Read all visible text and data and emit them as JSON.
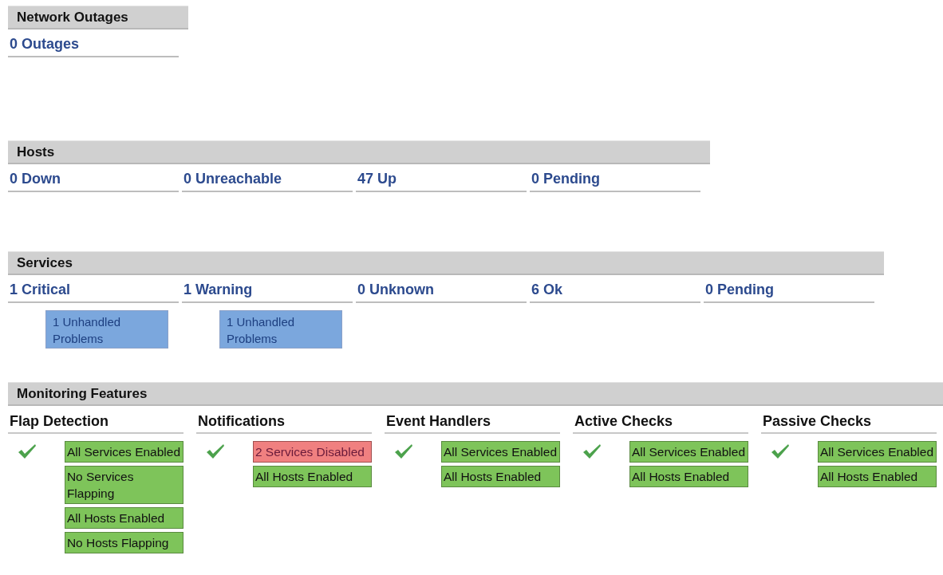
{
  "network_outages": {
    "title": "Network Outages",
    "items": [
      {
        "label": "0 Outages"
      }
    ]
  },
  "hosts": {
    "title": "Hosts",
    "items": [
      {
        "label": "0 Down"
      },
      {
        "label": "0 Unreachable"
      },
      {
        "label": "47  Up"
      },
      {
        "label": "0 Pending"
      }
    ]
  },
  "services": {
    "title": "Services",
    "items": [
      {
        "label": "1 Critical",
        "problems": "1 Unhandled Problems"
      },
      {
        "label": "1 Warning",
        "problems": "1 Unhandled Problems"
      },
      {
        "label": "0 Unknown"
      },
      {
        "label": "6 Ok"
      },
      {
        "label": "0 Pending"
      }
    ]
  },
  "monitoring_features": {
    "title": "Monitoring Features",
    "features": [
      {
        "title": "Flap Detection",
        "enabled": true,
        "badges": [
          {
            "text": "All Services Enabled",
            "kind": "ok"
          },
          {
            "text": "No Services Flapping",
            "kind": "ok"
          },
          {
            "text": "All Hosts Enabled",
            "kind": "ok"
          },
          {
            "text": "No Hosts Flapping",
            "kind": "ok"
          }
        ]
      },
      {
        "title": "Notifications",
        "enabled": true,
        "badges": [
          {
            "text": "2 Services Disabled",
            "kind": "problem"
          },
          {
            "text": "All Hosts Enabled",
            "kind": "ok"
          }
        ]
      },
      {
        "title": "Event Handlers",
        "enabled": true,
        "badges": [
          {
            "text": "All Services Enabled",
            "kind": "ok"
          },
          {
            "text": "All Hosts Enabled",
            "kind": "ok"
          }
        ]
      },
      {
        "title": "Active Checks",
        "enabled": true,
        "badges": [
          {
            "text": "All Services Enabled",
            "kind": "ok"
          },
          {
            "text": "All Hosts Enabled",
            "kind": "ok"
          }
        ]
      },
      {
        "title": "Passive Checks",
        "enabled": true,
        "badges": [
          {
            "text": "All Services Enabled",
            "kind": "ok"
          },
          {
            "text": "All Hosts Enabled",
            "kind": "ok"
          }
        ]
      }
    ]
  }
}
